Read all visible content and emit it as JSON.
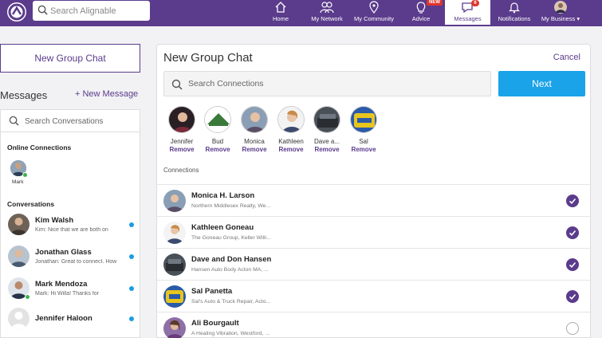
{
  "topbar": {
    "search_placeholder": "Search Alignable",
    "nav": [
      {
        "label": "Home",
        "icon": "home-icon"
      },
      {
        "label": "My Network",
        "icon": "people-icon"
      },
      {
        "label": "My Community",
        "icon": "location-pin-icon"
      },
      {
        "label": "Advice",
        "icon": "lightbulb-icon",
        "badge": "NEW"
      },
      {
        "label": "Messages",
        "icon": "chat-bubble-icon",
        "badge": "6",
        "active": true
      },
      {
        "label": "Notifications",
        "icon": "bell-icon"
      },
      {
        "label": "My Business ▾",
        "icon": "avatar"
      }
    ]
  },
  "left": {
    "new_group_label": "New Group Chat",
    "messages_title": "Messages",
    "new_message_label": "+ New Message",
    "search_placeholder": "Search Conversations",
    "online_label": "Online Connections",
    "online": [
      {
        "name": "Mark"
      }
    ],
    "conversations_label": "Conversations",
    "conversations": [
      {
        "name": "Kim Walsh",
        "preview": "Kim: Nice that we are both on",
        "unread": true
      },
      {
        "name": "Jonathan Glass",
        "preview": "Jonathan: Great to connect. How",
        "unread": true
      },
      {
        "name": "Mark Mendoza",
        "preview": "Mark: Hi Willa! Thanks for",
        "unread": true,
        "online": true
      },
      {
        "name": "Jennifer Haloon",
        "preview": "",
        "unread": true
      }
    ]
  },
  "main": {
    "title": "New Group Chat",
    "cancel_label": "Cancel",
    "search_placeholder": "Search Connections",
    "next_label": "Next",
    "remove_label": "Remove",
    "selected": [
      {
        "name": "Jennifer"
      },
      {
        "name": "Bud"
      },
      {
        "name": "Monica"
      },
      {
        "name": "Kathleen"
      },
      {
        "name": "Dave a..."
      },
      {
        "name": "Sal"
      }
    ],
    "connections_label": "Connections",
    "connections": [
      {
        "name": "Monica H. Larson",
        "sub": "Northern Middlesex Realty, We...",
        "checked": true
      },
      {
        "name": "Kathleen Goneau",
        "sub": "The Goneau Group, Keller Willi...",
        "checked": true
      },
      {
        "name": "Dave and Don Hansen",
        "sub": "Hansen Auto Body Acton MA, ...",
        "checked": true
      },
      {
        "name": "Sal Panetta",
        "sub": "Sal's Auto & Truck Repair, Acto...",
        "checked": true
      },
      {
        "name": "Ali Bourgault",
        "sub": "A Healing Vibration, Westford, ...",
        "checked": false
      }
    ]
  },
  "colors": {
    "brand": "#5b3b8c",
    "accent": "#1aa3e8",
    "online": "#3cb44b",
    "unread": "#1a9de0"
  }
}
